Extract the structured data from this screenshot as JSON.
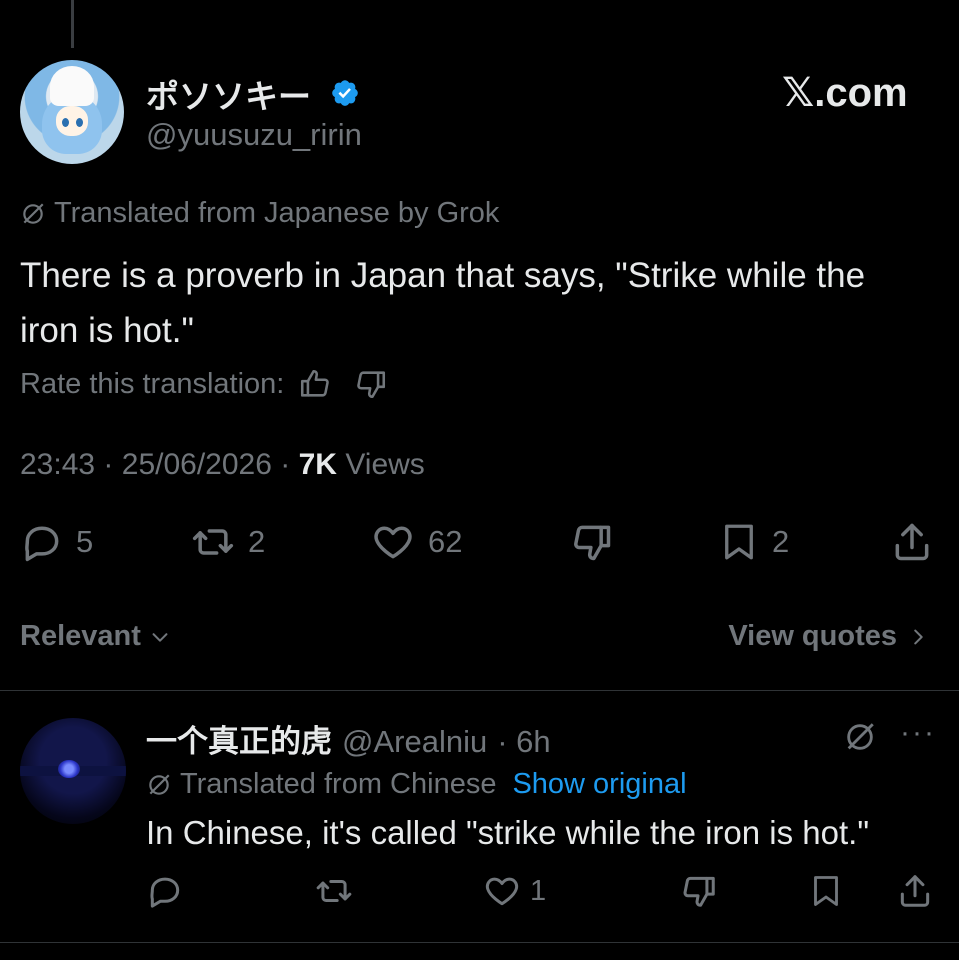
{
  "post": {
    "author_name": "ポソソキー",
    "author_handle": "@yuusuzu_ririn",
    "brand": "𝕏.com",
    "translated_label": "Translated from Japanese by Grok",
    "text": "There is a proverb in Japan that says, \"Strike while the iron is hot.\"",
    "rate_label": "Rate this translation:",
    "time": "23:43",
    "date": "25/06/2026",
    "views_count": "7K",
    "views_label": "Views",
    "sep": "·",
    "stats": {
      "replies": "5",
      "reposts": "2",
      "likes": "62",
      "bookmarks": "2"
    }
  },
  "sort": {
    "label": "Relevant",
    "view_quotes": "View quotes"
  },
  "reply": {
    "author_name": "一个真正的虎",
    "author_handle": "@Arealniu",
    "time": "· 6h",
    "more": "···",
    "translated_label": "Translated from Chinese",
    "show_original": "Show original",
    "text": "In Chinese, it's called \"strike while the iron is hot.\"",
    "likes": "1"
  },
  "colors": {
    "background": "#000000",
    "text": "#e7e9ea",
    "muted": "#71767b",
    "accent": "#1d9bf0",
    "verified": "#1d9bf0"
  }
}
